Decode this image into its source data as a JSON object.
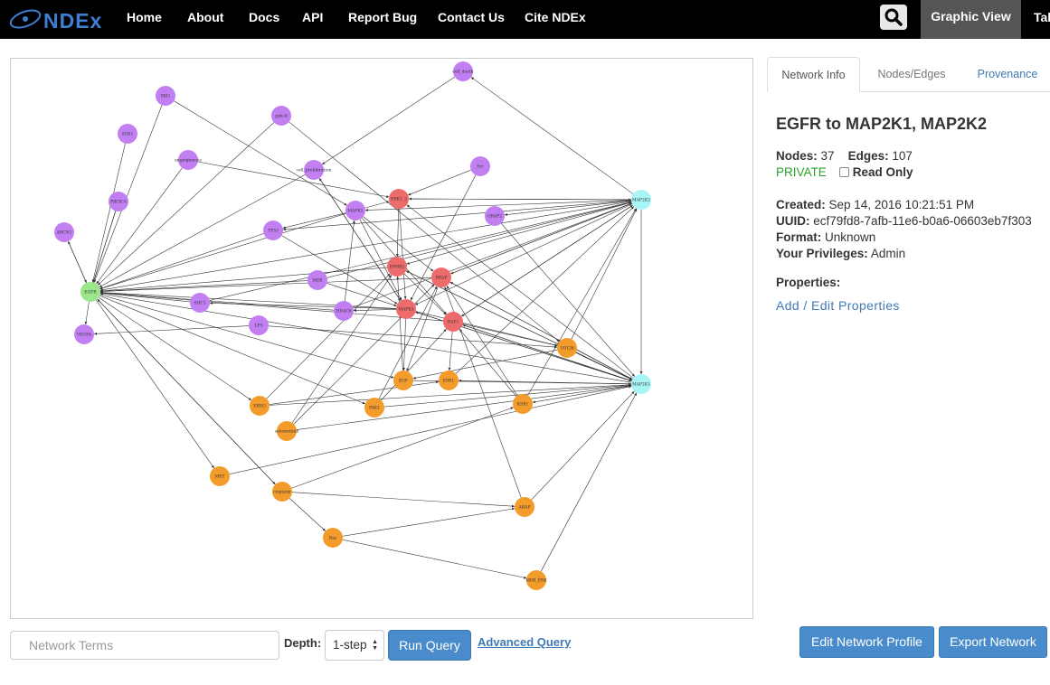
{
  "navbar": {
    "logo_text": "NDEx",
    "links": [
      "Home",
      "About",
      "Docs",
      "API",
      "Report Bug",
      "Contact Us",
      "Cite NDEx"
    ],
    "graphic_view_label": "Graphic View",
    "table_view_label": "Tal",
    "colors": {
      "background": "#000000",
      "active_tab": "#555555",
      "logo": "#3d7fd1"
    }
  },
  "graph": {
    "colors": {
      "purple": "#c27ff2",
      "red": "#ee6b6b",
      "orange": "#f39c2b",
      "cyan": "#a7f5f7",
      "green": "#9be68a",
      "edge": "#333333"
    },
    "nodes": [
      {
        "id": "cell_death",
        "color": "purple"
      },
      {
        "id": "SKI1",
        "color": "purple"
      },
      {
        "id": "ppk-it",
        "color": "purple"
      },
      {
        "id": "SOS1",
        "color": "purple"
      },
      {
        "id": "angiogenesis",
        "color": "purple"
      },
      {
        "id": "cell_proliferation",
        "color": "purple"
      },
      {
        "id": "Src",
        "color": "purple"
      },
      {
        "id": "PIK3CA",
        "color": "purple"
      },
      {
        "id": "MAPK1",
        "color": "purple"
      },
      {
        "id": "GRAP2",
        "color": "purple"
      },
      {
        "id": "ARCN1",
        "color": "purple"
      },
      {
        "id": "TP53",
        "color": "purple"
      },
      {
        "id": "MEK",
        "color": "purple"
      },
      {
        "id": "SHC1",
        "color": "purple"
      },
      {
        "id": "HDAC6",
        "color": "purple"
      },
      {
        "id": "LPS",
        "color": "purple"
      },
      {
        "id": "VEGFA",
        "color": "purple"
      },
      {
        "id": "ERK1_2",
        "color": "red"
      },
      {
        "id": "EPHB2",
        "color": "red"
      },
      {
        "id": "BRAF",
        "color": "red"
      },
      {
        "id": "MAPK3",
        "color": "red"
      },
      {
        "id": "RAF1",
        "color": "red"
      },
      {
        "id": "MAP2K2",
        "color": "cyan"
      },
      {
        "id": "MAP2K1",
        "color": "cyan"
      },
      {
        "id": "EGFR",
        "color": "green"
      },
      {
        "id": "U0126",
        "color": "orange"
      },
      {
        "id": "EGF",
        "color": "orange"
      },
      {
        "id": "ESR1",
        "color": "orange"
      },
      {
        "id": "KSR1",
        "color": "orange"
      },
      {
        "id": "EREG",
        "color": "orange"
      },
      {
        "id": "PAK1",
        "color": "orange"
      },
      {
        "id": "selumetinib",
        "color": "orange"
      },
      {
        "id": "MET",
        "color": "orange"
      },
      {
        "id": "cisplatin",
        "color": "orange"
      },
      {
        "id": "ARAF",
        "color": "orange"
      },
      {
        "id": "Ras",
        "color": "orange"
      },
      {
        "id": "MEK_ERK",
        "color": "orange"
      }
    ]
  },
  "side_panel": {
    "tabs": [
      "Network Info",
      "Nodes/Edges",
      "Provenance"
    ],
    "title": "EGFR to MAP2K1, MAP2K2",
    "nodes_label": "Nodes:",
    "nodes_count": "37",
    "edges_label": "Edges:",
    "edges_count": "107",
    "visibility": "PRIVATE",
    "read_only_label": "Read Only",
    "created_label": "Created:",
    "created_value": "Sep 14, 2016 10:21:51 PM",
    "uuid_label": "UUID:",
    "uuid_value": "ecf79fd8-7afb-11e6-b0a6-06603eb7f303",
    "format_label": "Format:",
    "format_value": "Unknown",
    "privileges_label": "Your Privileges:",
    "privileges_value": "Admin",
    "properties_label": "Properties:",
    "add_edit_label": "Add / Edit Properties"
  },
  "query": {
    "placeholder": "Network Terms",
    "depth_label": "Depth:",
    "depth_value": "1-step",
    "run_label": "Run Query",
    "advanced_label": "Advanced Query"
  },
  "actions": {
    "edit_label": "Edit Network Profile",
    "export_label": "Export Network"
  }
}
